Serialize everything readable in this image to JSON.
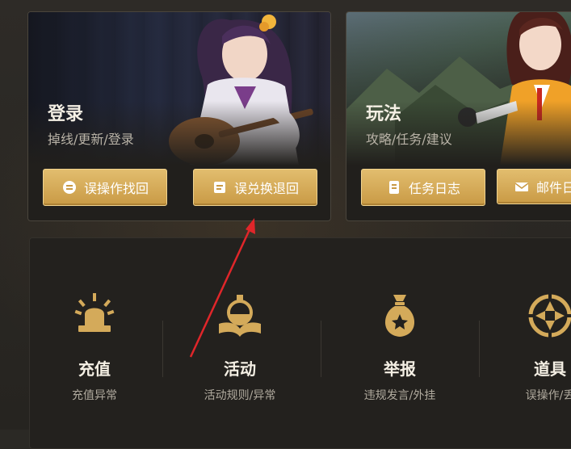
{
  "cards": {
    "login": {
      "title": "登录",
      "subtitle": "掉线/更新/登录",
      "buttons": [
        {
          "label": "误操作找回",
          "icon": "recover-icon"
        },
        {
          "label": "误兑换退回",
          "icon": "exchange-icon"
        }
      ]
    },
    "play": {
      "title": "玩法",
      "subtitle": "攻略/任务/建议",
      "buttons": [
        {
          "label": "任务日志",
          "icon": "task-log-icon"
        },
        {
          "label": "邮件日",
          "icon": "mail-icon"
        }
      ]
    }
  },
  "categories": [
    {
      "title": "充值",
      "subtitle": "充值异常",
      "icon": "alarm-light-icon"
    },
    {
      "title": "活动",
      "subtitle": "活动规则/异常",
      "icon": "potion-book-icon"
    },
    {
      "title": "举报",
      "subtitle": "违规发言/外挂",
      "icon": "money-bag-icon"
    },
    {
      "title": "道具",
      "subtitle": "误操作/丢",
      "icon": "gear-target-icon"
    }
  ],
  "colors": {
    "accent_gold": "#d4aa5a",
    "annotation_arrow": "#e0262a"
  }
}
